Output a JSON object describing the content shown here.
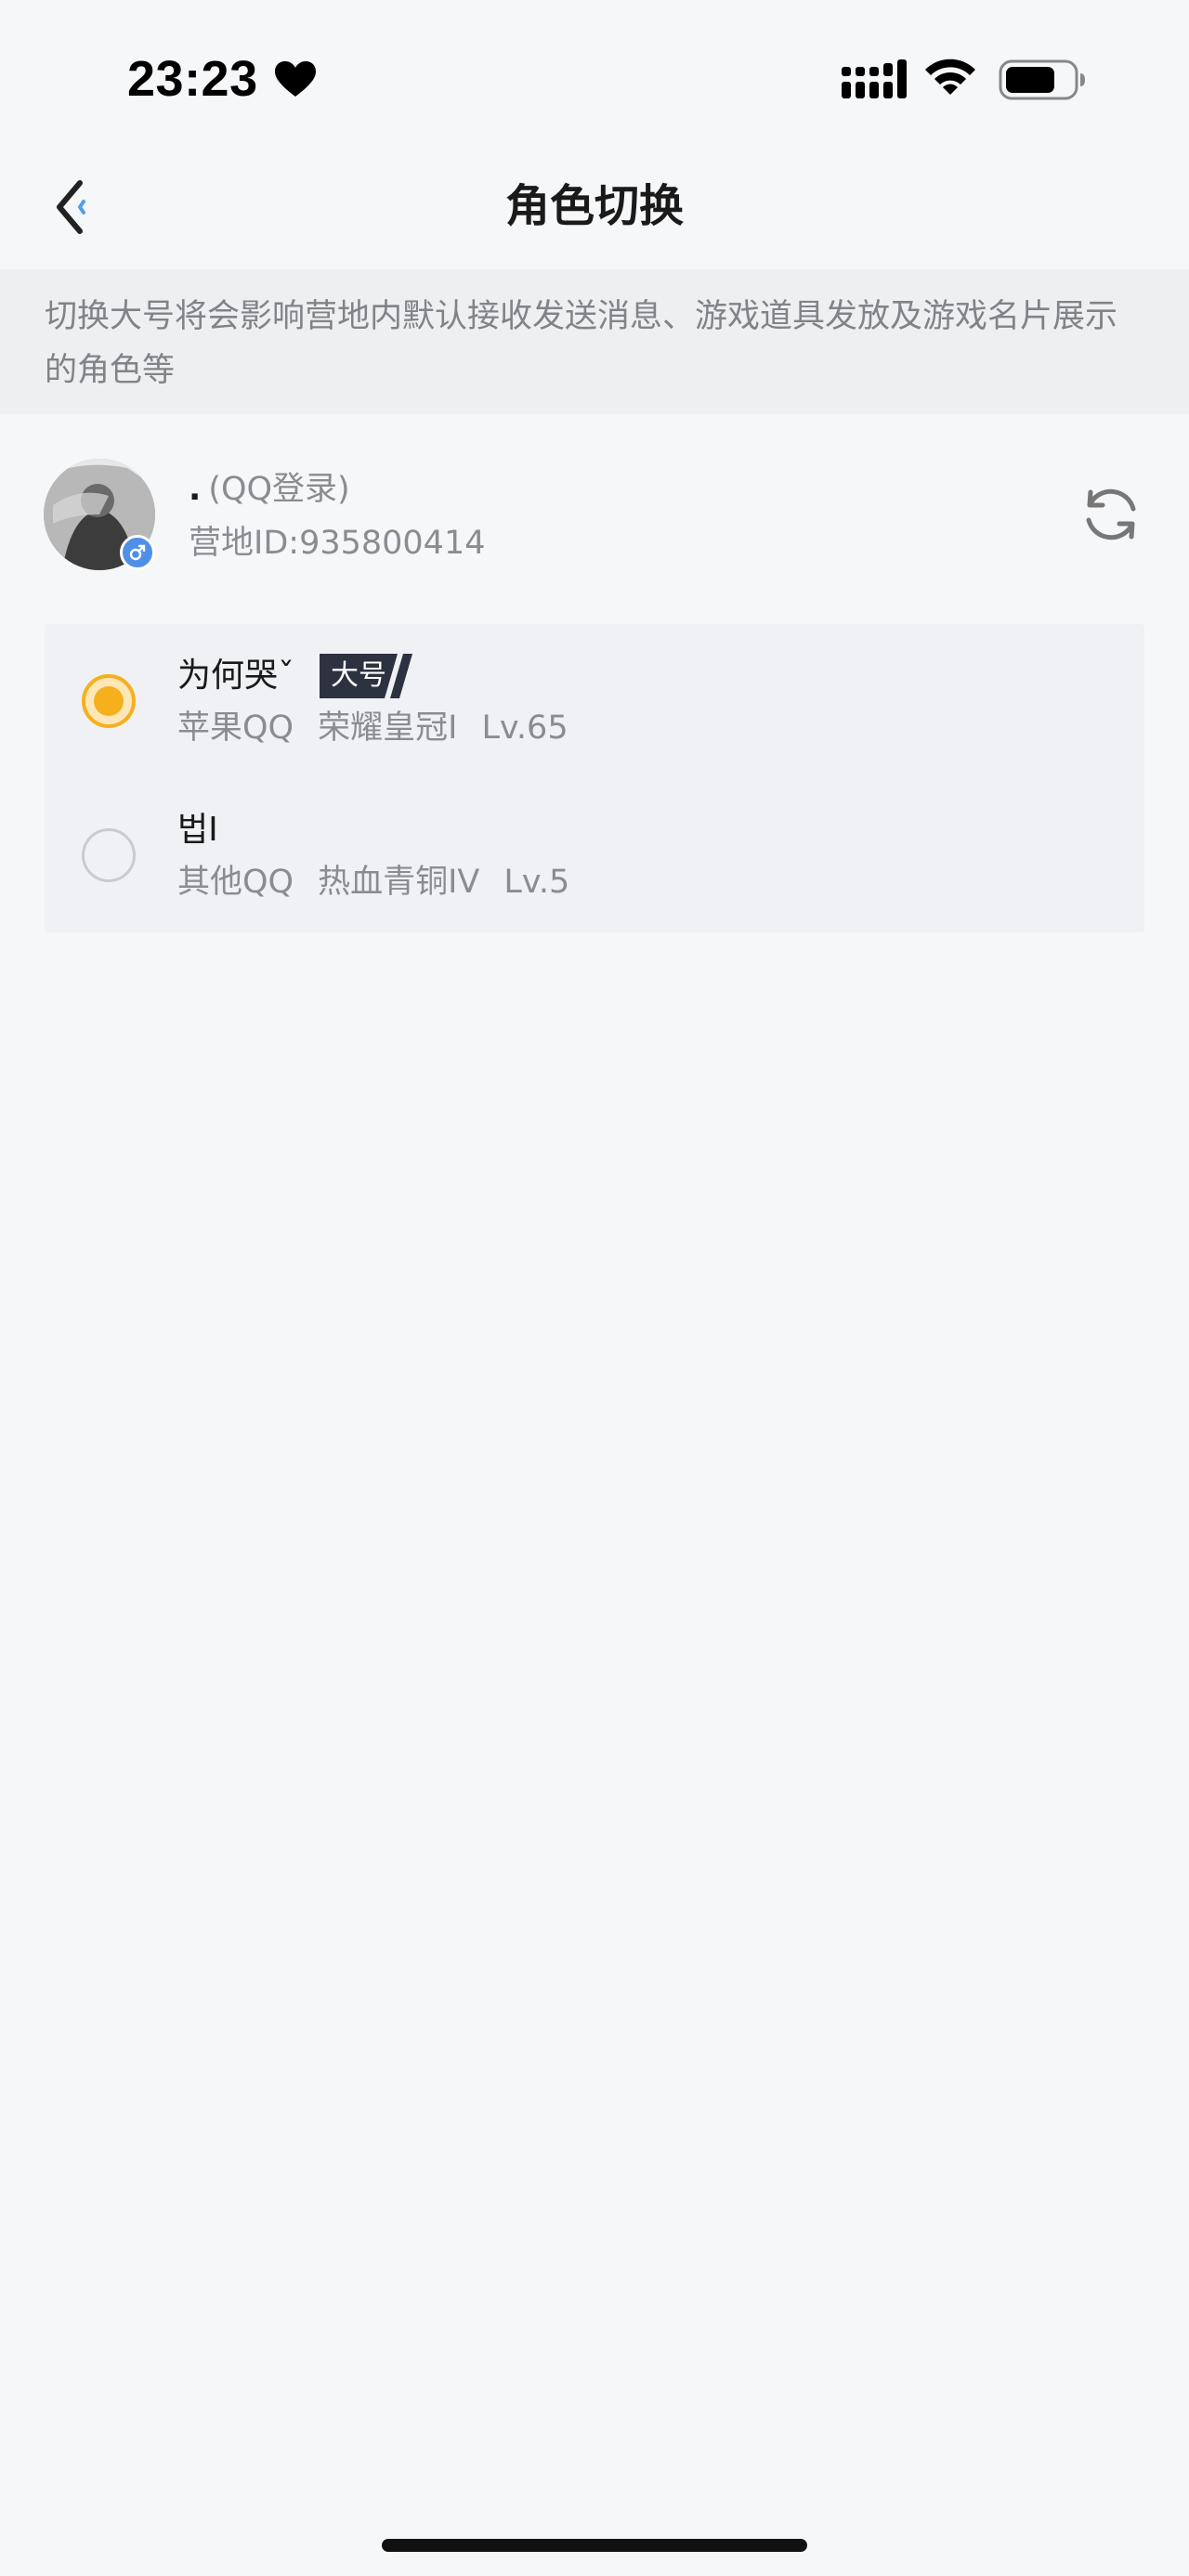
{
  "status_bar": {
    "time": "23:23",
    "icons": [
      "heart-icon",
      "signal-icon",
      "wifi-icon",
      "battery-icon"
    ]
  },
  "nav": {
    "title": "角色切换",
    "back_icon": "chevron-left-icon"
  },
  "notice": {
    "text": "切换大号将会影响营地内默认接收发送消息、游戏道具发放及游戏名片展示的角色等"
  },
  "account": {
    "name": ".",
    "login_type": "(QQ登录)",
    "camp_id": "营地ID:935800414",
    "gender_icon": "male-icon",
    "refresh_icon": "refresh-icon"
  },
  "roles": [
    {
      "name": "为何哭ˇ",
      "badge": "大号",
      "selected": true,
      "platform": "苹果QQ",
      "rank": "荣耀皇冠I",
      "level": "Lv.65"
    },
    {
      "name": "법I",
      "badge": "",
      "selected": false,
      "platform": "其他QQ",
      "rank": "热血青铜IV",
      "level": "Lv.5"
    }
  ],
  "colors": {
    "accent": "#f6b01e",
    "badge_bg": "#2d3240",
    "gender_badge": "#4f8fe8",
    "page_bg": "#f6f7f9",
    "notice_bg": "#eeeff1",
    "card_bg": "#eff1f4"
  }
}
